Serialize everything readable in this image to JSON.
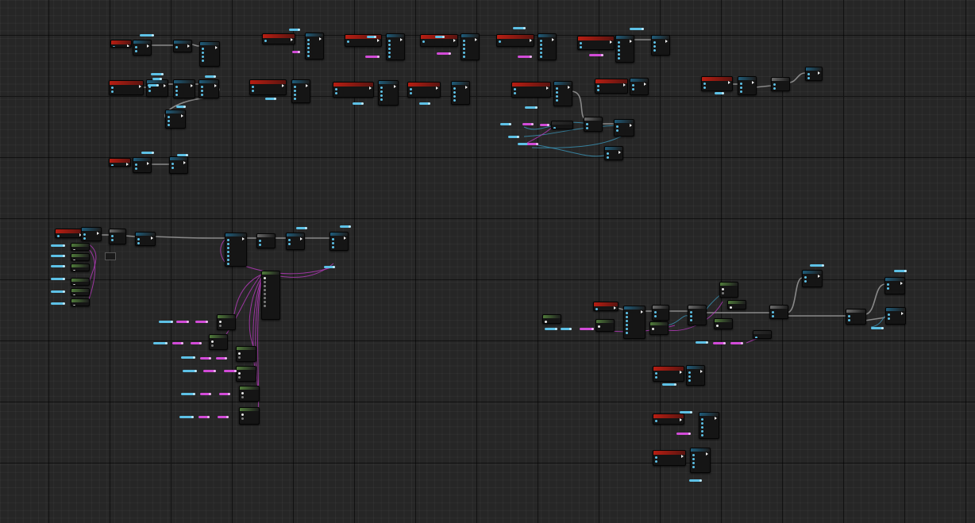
{
  "graph": {
    "name": "blueprint-event-graph",
    "colors": {
      "background": "#262626",
      "event": "#b81e12",
      "function": "#1f5c7a",
      "pure": "#6b6b6b",
      "struct": "#4f7a3a",
      "exec_wire": "#9a9a9a",
      "data_wire": "#3a8fb0",
      "vector_wire": "#b03ab6",
      "pin_float": "#5dc1e6",
      "pin_vector": "#d24bd8",
      "pin_bool": "#9c1e1e"
    },
    "node_labels": {
      "event_node": "",
      "function_node": "",
      "pure_node": "",
      "struct_node": ""
    }
  }
}
